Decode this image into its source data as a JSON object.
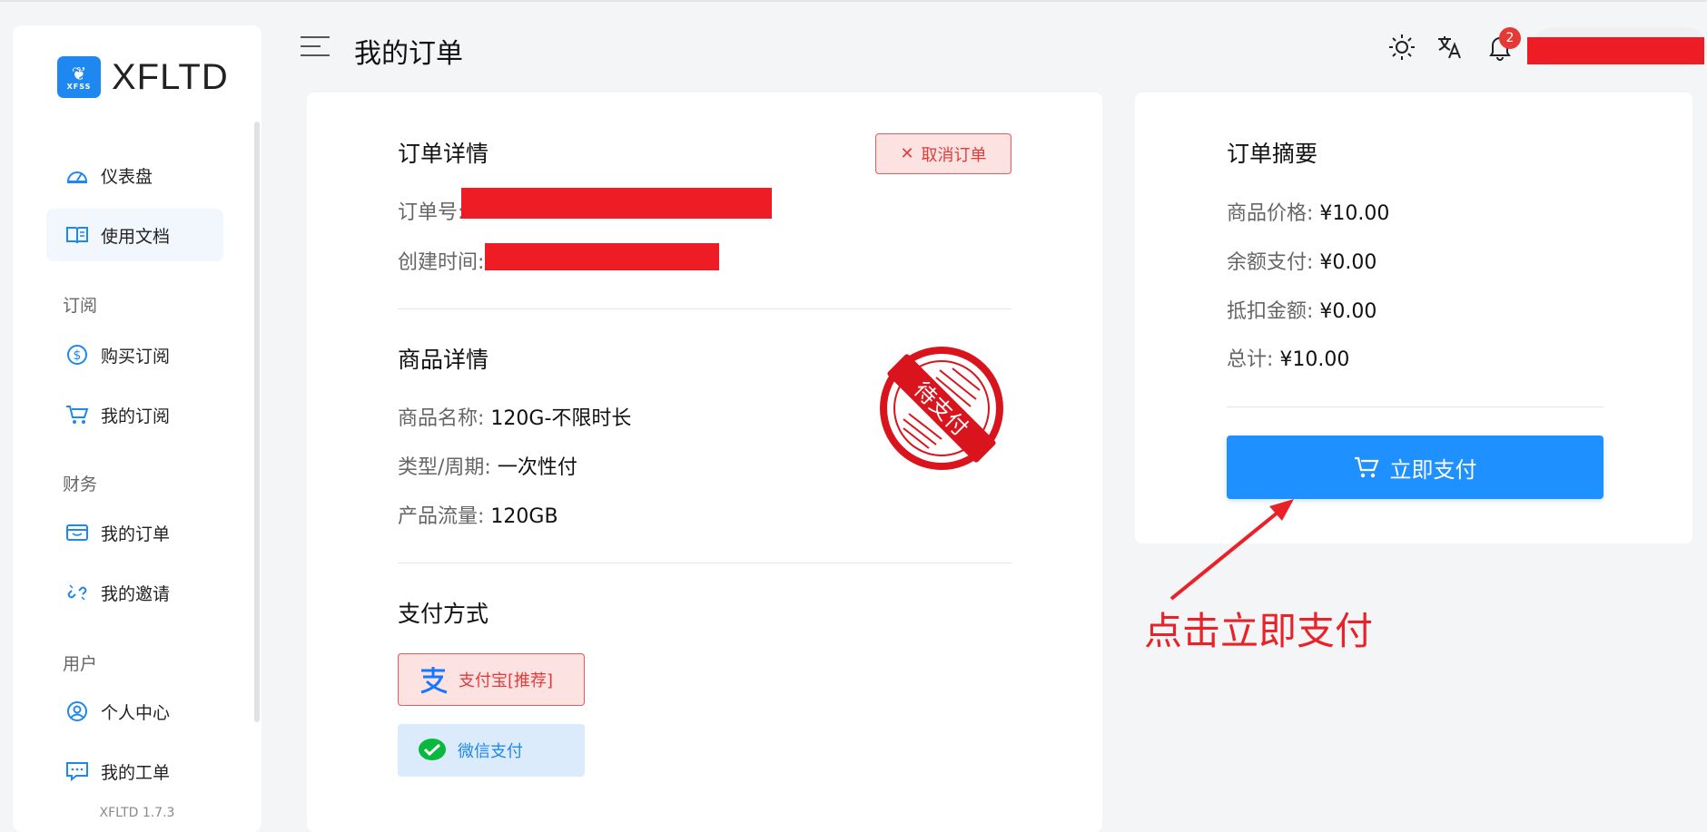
{
  "app": {
    "name": "XFLTD",
    "logo_text": "XFSS",
    "version": "XFLTD 1.7.3"
  },
  "sidebar": {
    "items": [
      {
        "label": "仪表盘",
        "icon": "dashboard-icon"
      },
      {
        "label": "使用文档",
        "icon": "book-icon",
        "active": true
      },
      {
        "label": "购买订阅",
        "icon": "dollar-icon"
      },
      {
        "label": "我的订阅",
        "icon": "cart-icon"
      },
      {
        "label": "我的订单",
        "icon": "wallet-icon"
      },
      {
        "label": "我的邀请",
        "icon": "link-icon"
      },
      {
        "label": "个人中心",
        "icon": "user-icon"
      },
      {
        "label": "我的工单",
        "icon": "chat-icon"
      }
    ],
    "groups": [
      "订阅",
      "财务",
      "用户"
    ]
  },
  "header": {
    "title": "我的订单",
    "notification_count": "2",
    "icons": [
      "menu-icon",
      "sun-icon",
      "translate-icon",
      "bell-icon"
    ]
  },
  "order_detail": {
    "title": "订单详情",
    "cancel_label": "取消订单",
    "order_no_label": "订单号:",
    "created_label": "创建时间:"
  },
  "product_detail": {
    "title": "商品详情",
    "name_label": "商品名称:",
    "name_value": "120G-不限时长",
    "type_label": "类型/周期:",
    "type_value": "一次性付",
    "traffic_label": "产品流量:",
    "traffic_value": "120GB",
    "stamp_text": "待支付"
  },
  "payment": {
    "title": "支付方式",
    "options": [
      {
        "label": "支付宝[推荐]",
        "icon": "alipay-icon",
        "selected": true
      },
      {
        "label": "微信支付",
        "icon": "wechat-icon",
        "selected": false
      }
    ]
  },
  "summary": {
    "title": "订单摘要",
    "price_label": "商品价格:",
    "price_value": "¥10.00",
    "balance_label": "余额支付:",
    "balance_value": "¥0.00",
    "discount_label": "抵扣金额:",
    "discount_value": "¥0.00",
    "total_label": "总计:",
    "total_value": "¥10.00",
    "pay_now_label": "立即支付"
  },
  "annotation": {
    "text": "点击立即支付"
  },
  "colors": {
    "accent": "#1e90ff",
    "danger": "#e03c3c",
    "redaction": "#ee1d25"
  }
}
